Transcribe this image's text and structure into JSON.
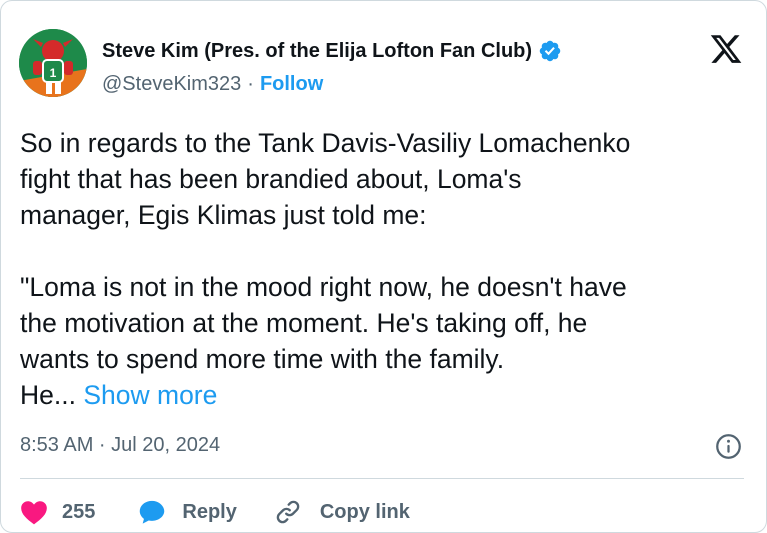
{
  "author": {
    "display_name": "Steve Kim (Pres. of the Elija Lofton Fan Club)",
    "handle": "@SteveKim323",
    "separator": "·",
    "follow_label": "Follow",
    "verified": true,
    "avatar_colors": {
      "background": "#1e8a4a",
      "accent": "#e8731c",
      "figure": "#d42a2a"
    }
  },
  "tweet": {
    "lines_paragraph_1": [
      "So in regards to the Tank Davis-Vasiliy Lomachenko",
      "fight that has been brandied about, Loma's",
      "manager, Egis Klimas just told me:"
    ],
    "lines_paragraph_2": [
      "\"Loma is not in the mood right now, he doesn't have",
      "the motivation at the moment. He's taking off, he",
      "wants to spend more time with the family."
    ],
    "truncated_prefix": "He...",
    "show_more_label": "Show more"
  },
  "meta": {
    "timestamp": "8:53 AM · Jul 20, 2024"
  },
  "actions": {
    "like_count": "255",
    "reply_label": "Reply",
    "copy_link_label": "Copy link"
  },
  "colors": {
    "accent": "#1d9bf0",
    "like": "#f91880",
    "text": "#0f1419",
    "secondary": "#536471",
    "border": "#cfd9de"
  },
  "icons": [
    "verified-badge-icon",
    "x-logo-icon",
    "info-icon",
    "heart-icon",
    "reply-bubble-icon",
    "link-icon"
  ]
}
